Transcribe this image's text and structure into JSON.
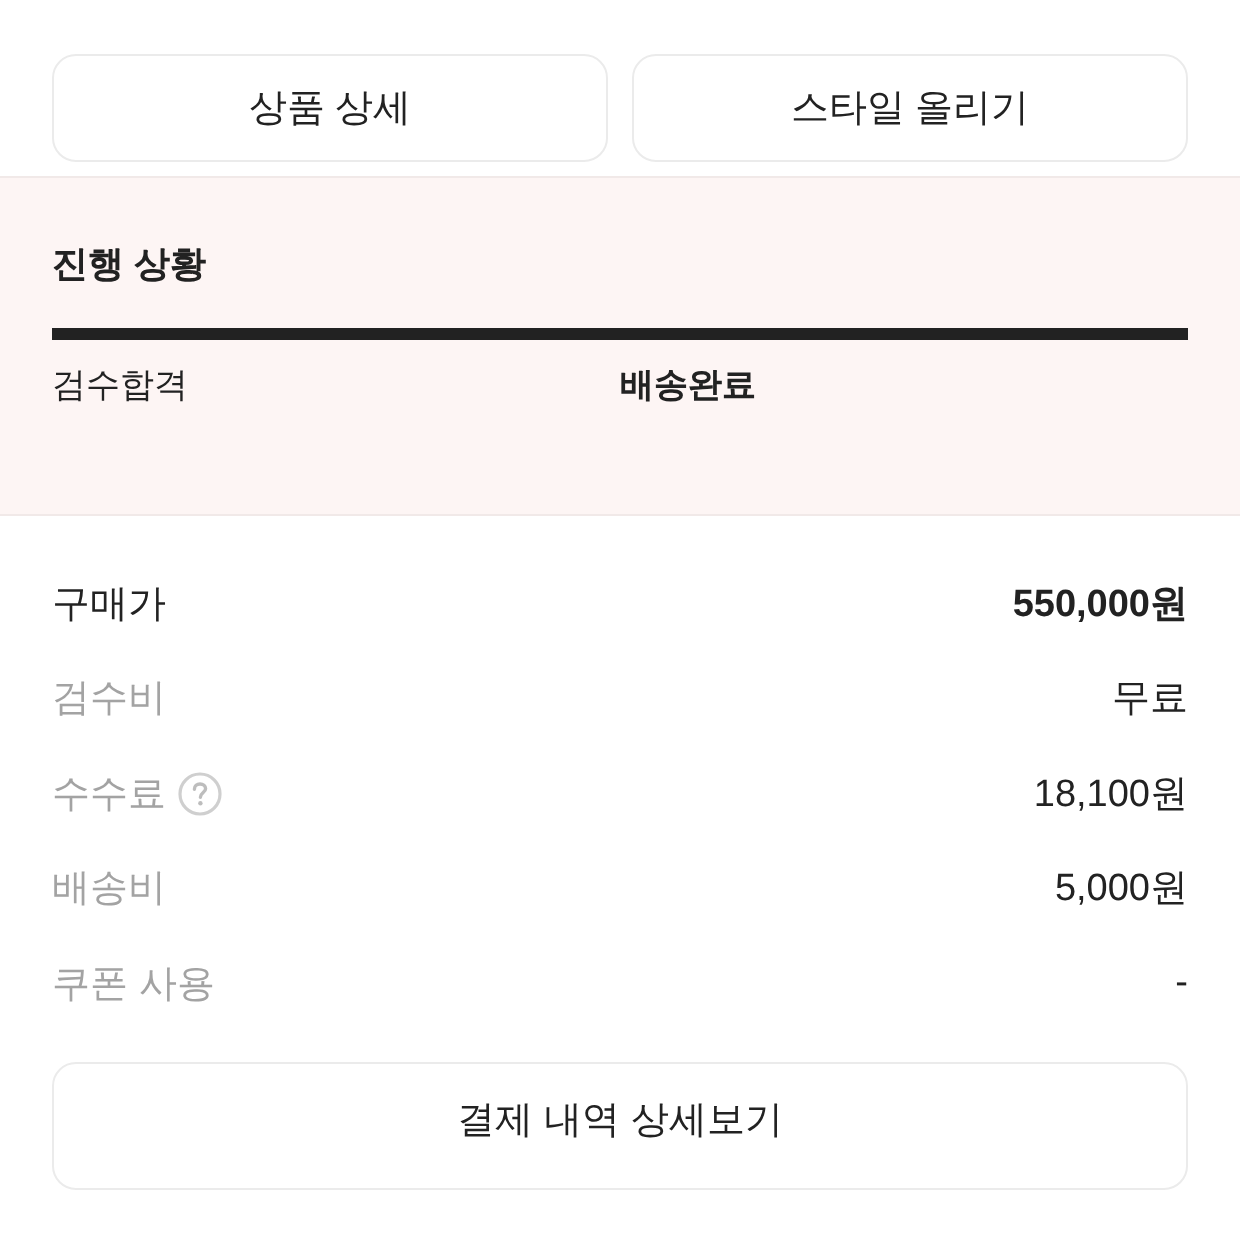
{
  "top_buttons": [
    "상품 상세",
    "스타일 올리기"
  ],
  "progress": {
    "title": "진행 상황",
    "level": 1,
    "steps": [
      {
        "label": "검수합격",
        "selected": false
      },
      {
        "label": "배송완료",
        "selected": true
      }
    ]
  },
  "price_rows": [
    {
      "label": "구매가",
      "value": "550,000원",
      "kind": "total",
      "info": false
    },
    {
      "label": "검수비",
      "value": "무료",
      "kind": "fee",
      "info": false
    },
    {
      "label": "수수료",
      "value": "18,100원",
      "kind": "fee",
      "info": true
    },
    {
      "label": "배송비",
      "value": "5,000원",
      "kind": "fee",
      "info": false
    },
    {
      "label": "쿠폰 사용",
      "value": "-",
      "kind": "fee",
      "info": false
    }
  ],
  "bottom_button": "결제 내역 상세보기"
}
